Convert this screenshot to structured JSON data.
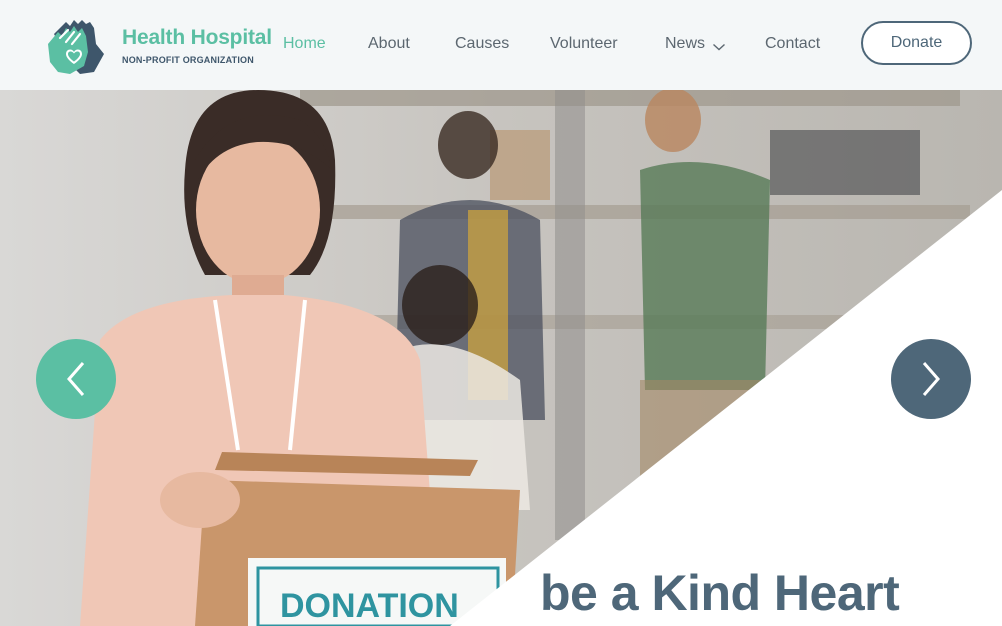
{
  "brand": {
    "title": "Health Hospital",
    "subtitle": "NON-PROFIT ORGANIZATION",
    "logo_icon": "hands-heart-icon"
  },
  "nav": {
    "items": [
      {
        "label": "Home",
        "active": true
      },
      {
        "label": "About",
        "active": false
      },
      {
        "label": "Causes",
        "active": false
      },
      {
        "label": "Volunteer",
        "active": false
      },
      {
        "label": "News",
        "active": false,
        "has_dropdown": true
      },
      {
        "label": "Contact",
        "active": false
      }
    ],
    "donate_label": "Donate"
  },
  "hero": {
    "headline": "be a Kind Heart",
    "box_label": "DONATION",
    "prev_icon": "chevron-left-icon",
    "next_icon": "chevron-right-icon"
  },
  "colors": {
    "accent": "#5bbfa3",
    "primary": "#4e6779",
    "text": "#5c6770",
    "header_bg": "#f4f7f8"
  }
}
